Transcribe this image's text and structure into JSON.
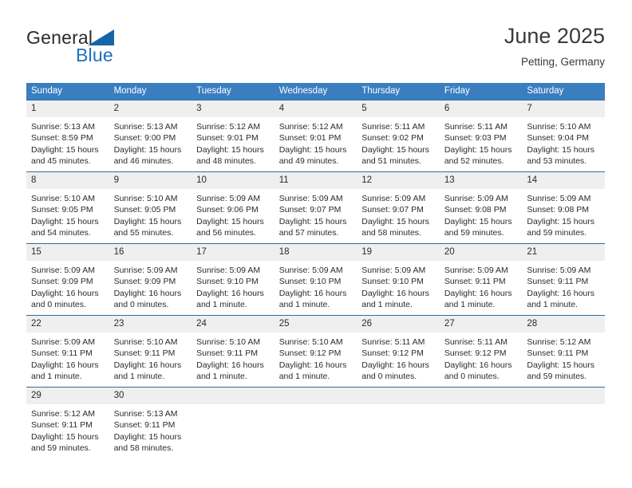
{
  "brand": {
    "name_part1": "General",
    "name_part2": "Blue",
    "triangle_icon": "blue-triangle-logo-icon",
    "accent_color": "#1c71bd"
  },
  "header": {
    "month_title": "June 2025",
    "location": "Petting, Germany"
  },
  "theme": {
    "header_row_bg": "#3a7ec0",
    "row_divider": "#2e6da4",
    "daynum_bg": "#efefef",
    "text": "#2b2b2b"
  },
  "weekdays": [
    "Sunday",
    "Monday",
    "Tuesday",
    "Wednesday",
    "Thursday",
    "Friday",
    "Saturday"
  ],
  "weeks": [
    [
      {
        "day": "1",
        "sunrise": "Sunrise: 5:13 AM",
        "sunset": "Sunset: 8:59 PM",
        "daylight": "Daylight: 15 hours and 45 minutes."
      },
      {
        "day": "2",
        "sunrise": "Sunrise: 5:13 AM",
        "sunset": "Sunset: 9:00 PM",
        "daylight": "Daylight: 15 hours and 46 minutes."
      },
      {
        "day": "3",
        "sunrise": "Sunrise: 5:12 AM",
        "sunset": "Sunset: 9:01 PM",
        "daylight": "Daylight: 15 hours and 48 minutes."
      },
      {
        "day": "4",
        "sunrise": "Sunrise: 5:12 AM",
        "sunset": "Sunset: 9:01 PM",
        "daylight": "Daylight: 15 hours and 49 minutes."
      },
      {
        "day": "5",
        "sunrise": "Sunrise: 5:11 AM",
        "sunset": "Sunset: 9:02 PM",
        "daylight": "Daylight: 15 hours and 51 minutes."
      },
      {
        "day": "6",
        "sunrise": "Sunrise: 5:11 AM",
        "sunset": "Sunset: 9:03 PM",
        "daylight": "Daylight: 15 hours and 52 minutes."
      },
      {
        "day": "7",
        "sunrise": "Sunrise: 5:10 AM",
        "sunset": "Sunset: 9:04 PM",
        "daylight": "Daylight: 15 hours and 53 minutes."
      }
    ],
    [
      {
        "day": "8",
        "sunrise": "Sunrise: 5:10 AM",
        "sunset": "Sunset: 9:05 PM",
        "daylight": "Daylight: 15 hours and 54 minutes."
      },
      {
        "day": "9",
        "sunrise": "Sunrise: 5:10 AM",
        "sunset": "Sunset: 9:05 PM",
        "daylight": "Daylight: 15 hours and 55 minutes."
      },
      {
        "day": "10",
        "sunrise": "Sunrise: 5:09 AM",
        "sunset": "Sunset: 9:06 PM",
        "daylight": "Daylight: 15 hours and 56 minutes."
      },
      {
        "day": "11",
        "sunrise": "Sunrise: 5:09 AM",
        "sunset": "Sunset: 9:07 PM",
        "daylight": "Daylight: 15 hours and 57 minutes."
      },
      {
        "day": "12",
        "sunrise": "Sunrise: 5:09 AM",
        "sunset": "Sunset: 9:07 PM",
        "daylight": "Daylight: 15 hours and 58 minutes."
      },
      {
        "day": "13",
        "sunrise": "Sunrise: 5:09 AM",
        "sunset": "Sunset: 9:08 PM",
        "daylight": "Daylight: 15 hours and 59 minutes."
      },
      {
        "day": "14",
        "sunrise": "Sunrise: 5:09 AM",
        "sunset": "Sunset: 9:08 PM",
        "daylight": "Daylight: 15 hours and 59 minutes."
      }
    ],
    [
      {
        "day": "15",
        "sunrise": "Sunrise: 5:09 AM",
        "sunset": "Sunset: 9:09 PM",
        "daylight": "Daylight: 16 hours and 0 minutes."
      },
      {
        "day": "16",
        "sunrise": "Sunrise: 5:09 AM",
        "sunset": "Sunset: 9:09 PM",
        "daylight": "Daylight: 16 hours and 0 minutes."
      },
      {
        "day": "17",
        "sunrise": "Sunrise: 5:09 AM",
        "sunset": "Sunset: 9:10 PM",
        "daylight": "Daylight: 16 hours and 1 minute."
      },
      {
        "day": "18",
        "sunrise": "Sunrise: 5:09 AM",
        "sunset": "Sunset: 9:10 PM",
        "daylight": "Daylight: 16 hours and 1 minute."
      },
      {
        "day": "19",
        "sunrise": "Sunrise: 5:09 AM",
        "sunset": "Sunset: 9:10 PM",
        "daylight": "Daylight: 16 hours and 1 minute."
      },
      {
        "day": "20",
        "sunrise": "Sunrise: 5:09 AM",
        "sunset": "Sunset: 9:11 PM",
        "daylight": "Daylight: 16 hours and 1 minute."
      },
      {
        "day": "21",
        "sunrise": "Sunrise: 5:09 AM",
        "sunset": "Sunset: 9:11 PM",
        "daylight": "Daylight: 16 hours and 1 minute."
      }
    ],
    [
      {
        "day": "22",
        "sunrise": "Sunrise: 5:09 AM",
        "sunset": "Sunset: 9:11 PM",
        "daylight": "Daylight: 16 hours and 1 minute."
      },
      {
        "day": "23",
        "sunrise": "Sunrise: 5:10 AM",
        "sunset": "Sunset: 9:11 PM",
        "daylight": "Daylight: 16 hours and 1 minute."
      },
      {
        "day": "24",
        "sunrise": "Sunrise: 5:10 AM",
        "sunset": "Sunset: 9:11 PM",
        "daylight": "Daylight: 16 hours and 1 minute."
      },
      {
        "day": "25",
        "sunrise": "Sunrise: 5:10 AM",
        "sunset": "Sunset: 9:12 PM",
        "daylight": "Daylight: 16 hours and 1 minute."
      },
      {
        "day": "26",
        "sunrise": "Sunrise: 5:11 AM",
        "sunset": "Sunset: 9:12 PM",
        "daylight": "Daylight: 16 hours and 0 minutes."
      },
      {
        "day": "27",
        "sunrise": "Sunrise: 5:11 AM",
        "sunset": "Sunset: 9:12 PM",
        "daylight": "Daylight: 16 hours and 0 minutes."
      },
      {
        "day": "28",
        "sunrise": "Sunrise: 5:12 AM",
        "sunset": "Sunset: 9:11 PM",
        "daylight": "Daylight: 15 hours and 59 minutes."
      }
    ],
    [
      {
        "day": "29",
        "sunrise": "Sunrise: 5:12 AM",
        "sunset": "Sunset: 9:11 PM",
        "daylight": "Daylight: 15 hours and 59 minutes."
      },
      {
        "day": "30",
        "sunrise": "Sunrise: 5:13 AM",
        "sunset": "Sunset: 9:11 PM",
        "daylight": "Daylight: 15 hours and 58 minutes."
      },
      {
        "day": "",
        "sunrise": "",
        "sunset": "",
        "daylight": ""
      },
      {
        "day": "",
        "sunrise": "",
        "sunset": "",
        "daylight": ""
      },
      {
        "day": "",
        "sunrise": "",
        "sunset": "",
        "daylight": ""
      },
      {
        "day": "",
        "sunrise": "",
        "sunset": "",
        "daylight": ""
      },
      {
        "day": "",
        "sunrise": "",
        "sunset": "",
        "daylight": ""
      }
    ]
  ]
}
